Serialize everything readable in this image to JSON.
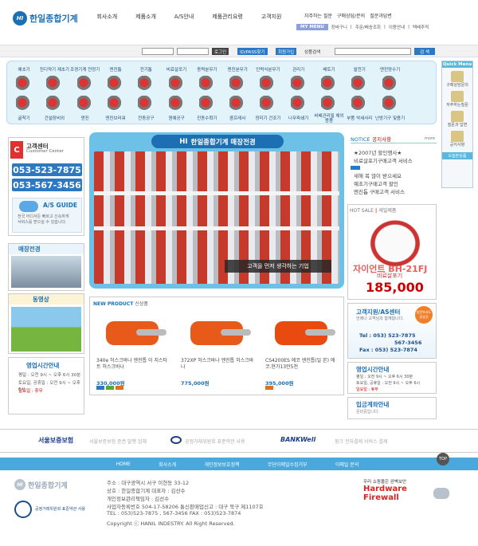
{
  "logo": {
    "hi": "HI",
    "text": "한일종합기계"
  },
  "gnb": [
    "회사소개",
    "제품소개",
    "A/S안내",
    "제품관리요령",
    "고객지원"
  ],
  "top_links": [
    "자주하는 질문",
    "구매상담/문의",
    "질문과답변"
  ],
  "mymenu": {
    "label": "MY MENU",
    "items": [
      "장바구니",
      "주문/배송조회",
      "이용안내",
      "택배추적"
    ]
  },
  "search": {
    "login": "로그인",
    "idpass": "ID/PASS찾기",
    "join": "회원가입",
    "label": "상품검색",
    "go": "검 색"
  },
  "categories_row1": [
    "예초기",
    "진디약기 제초기",
    "조경기계 전정기",
    "엔진톱",
    "전기톱",
    "비료살포기",
    "동력분무기",
    "엔진분무기",
    "인력식분무기",
    "관리기",
    "배토기",
    "발전기",
    "엔진양수기"
  ],
  "categories_row2": [
    "굴착기",
    "건설장비외",
    "엔진",
    "엔진브러워",
    "전동공구",
    "원예공구",
    "진동수확기",
    "콤프레서",
    "정미기 건조기",
    "나무파쇄기",
    "비배관리필 체외용품",
    "부품 악세사리",
    "난방기구 및용기"
  ],
  "quick_menu": {
    "header": "Quick Menu",
    "items": [
      "구매상담문의",
      "자주하는질문",
      "질문과 답변",
      "공지사항"
    ],
    "footer": "오늘본상품"
  },
  "customer_center": {
    "c": "C",
    "title": "고객센터",
    "subtitle": "Customer Center",
    "phone1": "053-523-7875",
    "phone2": "053-567-3456",
    "as_title": "A/S GUIDE",
    "as_text1": "전국 어디서든 빠르고 신속하게",
    "as_text2": "서비스를 받으실 수 있습니다."
  },
  "shop_title": "매장전경",
  "video_title": "동영상",
  "hours": {
    "title": "영업시간안내",
    "lines": [
      "평일 : 오전 9시 ~ 오후 6시 30분",
      "토요일, 공휴일 : 오전 9시 ~ 오후 6시",
      "일요일 : 휴무"
    ]
  },
  "banner": {
    "hi": "HI",
    "title": "한일종합기계 매장전경",
    "caption": "고객을 먼저 생각하는 기업"
  },
  "new_product": {
    "title": "NEW PRODUCT",
    "sub": "신상품",
    "items": [
      {
        "name": "340e 허스크바나 엔진톱 이 지스타트 허스크바나",
        "price": "330,000원"
      },
      {
        "name": "372XP 허스크바나 엔진톱 허스크바나",
        "price": "775,000원"
      },
      {
        "name": "CS4200ES 에코 엔진톱(일 본) 에코.현가13만5천",
        "price": "395,000원"
      }
    ]
  },
  "notice": {
    "title": "NOTICE",
    "sub": "공지사항",
    "more": "more",
    "items": [
      "★2007년 할인행사★",
      "비료살포기구매고객 서비스",
      "새해 복 많이 받으세요",
      "예초기구매고객 할인",
      "엔진톱 구매고객 서비스"
    ]
  },
  "hotsale": {
    "title": "HOT SALE",
    "sub": "세일제품",
    "name": "자이언트 BH-21FJ",
    "strike": "비료살포기",
    "price": "185,000"
  },
  "as_center": {
    "title": "고객지원/AS센터",
    "sub": "언제나 고객님과 함께합니다.",
    "badge": "방문하셔도 정성것",
    "tel1": "Tel : 053) 523-7875",
    "tel2": "567-3456",
    "fax": "Fax : 053) 523-7874"
  },
  "business": {
    "title": "영업시간안내",
    "lines": [
      "평일 : 오전 9시 ~ 오후 6시 30분",
      "토요일, 공휴일 : 오전 9시 ~ 오후 6시",
      "일요일 : 휴무"
    ]
  },
  "deposit": {
    "title": "입금계좌안내",
    "sub": "준비중입니다."
  },
  "partners": [
    {
      "logo": "서울보증보험",
      "desc": "서울보증보험 증권 발행 업체"
    },
    {
      "logo": "",
      "desc": "공정거래위원회 표준약관 사용"
    },
    {
      "logo": "BANKWell",
      "desc": "핑크 전자결제 서비스 결제"
    }
  ],
  "footer_nav": [
    "HOME",
    "회사소개",
    "개인정보보호정책",
    "무단이메일수집거부",
    "이메일 문의"
  ],
  "top": "TOP",
  "footer": {
    "logo_hi": "HI",
    "logo_text": "한일종합기계",
    "fair": "공정거래위원회 표준약관 사용",
    "lines": [
      "주소 : 대구광역시 서구 이현동 33-12",
      "상호 : 한일종합기계   대표자 : 김선수",
      "개인정보관리책임자 : 김선수",
      "사업자등록번호 504-17-58206   통신판매업신고 : 대구 북구 제1107호",
      "TEL : 053)523-7875 , 567-3456    FAX : 053)523-7874",
      "Copyright ⓒ HANIL INDESTRY. All Right Reserved."
    ],
    "fw_small": "우리 쇼핑몰은 완벽보안",
    "fw1": "Hardware",
    "fw2": "Firewall"
  },
  "colors": {
    "primary": "#1c6fb3",
    "nav": "#4aa8dc",
    "accent_red": "#c00000"
  }
}
